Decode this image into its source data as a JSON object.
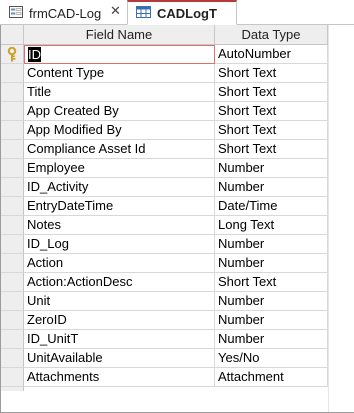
{
  "tabs": [
    {
      "label": "frmCAD-Log",
      "icon": "form-icon",
      "active": false
    },
    {
      "label": "CADLogT",
      "icon": "table-icon",
      "active": true
    }
  ],
  "close_glyph": "✕",
  "columns": {
    "field_name": "Field Name",
    "data_type": "Data Type"
  },
  "rows": [
    {
      "field": "ID",
      "type": "AutoNumber",
      "primary_key": true
    },
    {
      "field": "Content Type",
      "type": "Short Text"
    },
    {
      "field": "Title",
      "type": "Short Text"
    },
    {
      "field": "App Created By",
      "type": "Short Text"
    },
    {
      "field": "App Modified By",
      "type": "Short Text"
    },
    {
      "field": "Compliance Asset Id",
      "type": "Short Text"
    },
    {
      "field": "Employee",
      "type": "Number"
    },
    {
      "field": "ID_Activity",
      "type": "Number"
    },
    {
      "field": "EntryDateTime",
      "type": "Date/Time"
    },
    {
      "field": "Notes",
      "type": "Long Text"
    },
    {
      "field": "ID_Log",
      "type": "Number"
    },
    {
      "field": "Action",
      "type": "Number"
    },
    {
      "field": "Action:ActionDesc",
      "type": "Short Text"
    },
    {
      "field": "Unit",
      "type": "Number"
    },
    {
      "field": "ZeroID",
      "type": "Number"
    },
    {
      "field": "ID_UnitT",
      "type": "Number"
    },
    {
      "field": "UnitAvailable",
      "type": "Yes/No"
    },
    {
      "field": "Attachments",
      "type": "Attachment"
    }
  ],
  "colors": {
    "active_tab_accent": "#b73a3a",
    "key_icon": "#c9a227",
    "header_bg": "#eeeeee"
  }
}
